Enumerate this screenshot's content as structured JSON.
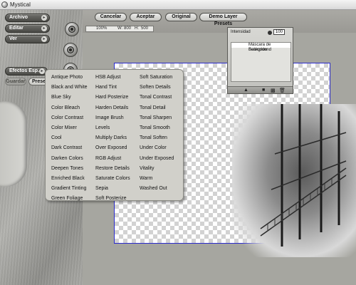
{
  "window": {
    "title": "Mystical"
  },
  "left_panel": {
    "archivo": "Archivo",
    "editar": "Editar",
    "ver": "Ver",
    "efectos": "Efectos Esp.",
    "guardar": "Guardar",
    "presets": "Preset"
  },
  "toolbar": {
    "cancel": "Cancelar",
    "accept": "Aceptar",
    "original": "Original",
    "demo_presets": "Demo Layer Presets",
    "zoom": "100%",
    "width_label": "W:",
    "width": "800",
    "height_label": "H:",
    "height": "500"
  },
  "layers": {
    "intensity_label": "Intensidad",
    "intensity_value": "100",
    "items": [
      "Máscara de Selección",
      "Background"
    ]
  },
  "effects_menu": {
    "col1": [
      "Antique Photo",
      "Black and White",
      "Blue Sky",
      "Color Bleach",
      "Color Contrast",
      "Color Mixer",
      "Cool",
      "Dark Contrast",
      "Darken Colors",
      "Deepen Tones",
      "Enriched Black",
      "Gradient Tinting",
      "Green Foliage"
    ],
    "col2": [
      "HSB Adjust",
      "Hand Tint",
      "Hard Posterize",
      "Harden Details",
      "Image Brush",
      "Levels",
      "Multiply Darks",
      "Over Exposed",
      "RGB Adjust",
      "Restore Details",
      "Saturate Colors",
      "Sepia",
      "Soft Posterize"
    ],
    "col3": [
      "Soft Saturation",
      "Soften Details",
      "Tonal Contrast",
      "Tonal Detail",
      "Tonal Sharpen",
      "Tonal Smooth",
      "Tonal Soften",
      "Under Color",
      "Under Exposed",
      "Vitality",
      "Warm",
      "Washed Out"
    ]
  },
  "colors": {
    "canvas_border": "#2a2acc",
    "menu_bg": "#d1d0ca"
  }
}
